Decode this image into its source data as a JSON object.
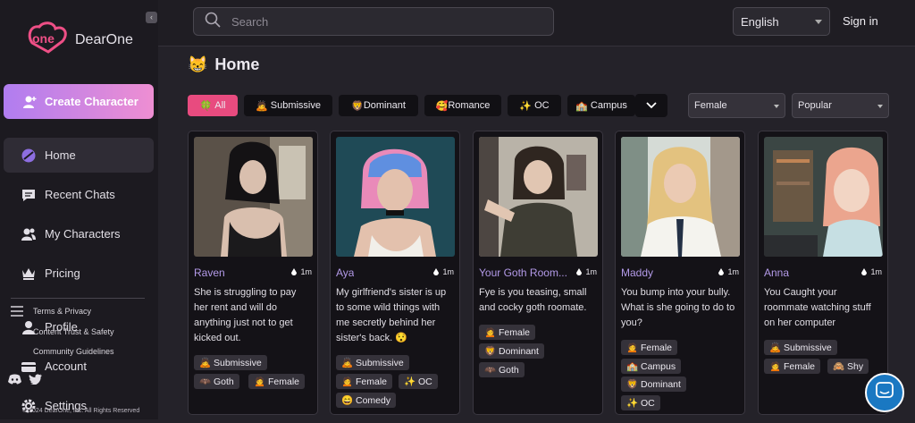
{
  "brand": {
    "name": "DearOne",
    "logo_mark": "one"
  },
  "sidebar": {
    "create_label": "Create Character",
    "nav": [
      {
        "label": "Home",
        "icon": "home-icon",
        "active": true
      },
      {
        "label": "Recent Chats",
        "icon": "chat-icon"
      },
      {
        "label": "My Characters",
        "icon": "users-icon"
      },
      {
        "label": "Pricing",
        "icon": "crown-icon"
      },
      {
        "label": "Profile",
        "icon": "user-icon"
      },
      {
        "label": "Account",
        "icon": "card-icon"
      },
      {
        "label": "Settings",
        "icon": "gear-icon"
      }
    ],
    "footer_links": [
      "Terms & Privacy",
      "Content Trust & Safety",
      "Community Guidelines"
    ],
    "copyright": "© 2024 DearOne, Inc. All Rights Reserved"
  },
  "header": {
    "search_placeholder": "Search",
    "language": "English",
    "signin_label": "Sign in"
  },
  "page": {
    "title": "Home",
    "title_icon": "😸"
  },
  "filters": {
    "chips": [
      {
        "emoji": "🍀",
        "label": "All",
        "selected": true
      },
      {
        "emoji": "🙇",
        "label": "Submissive"
      },
      {
        "emoji": "🦁",
        "label": "Dominant"
      },
      {
        "emoji": "🥰",
        "label": "Romance"
      },
      {
        "emoji": "✨",
        "label": "OC"
      },
      {
        "emoji": "🏫",
        "label": "Campus"
      }
    ],
    "gender": "Female",
    "sort": "Popular"
  },
  "cards": [
    {
      "name": "Raven",
      "time": "1m",
      "desc": "She is struggling to pay her rent and will do anything just not to get kicked out.",
      "tags": [
        [
          "🙇",
          "Submissive"
        ],
        [
          "🦇",
          "Goth"
        ],
        [
          "🙍",
          "Female"
        ]
      ]
    },
    {
      "name": "Aya",
      "time": "1m",
      "desc": "My girlfriend's sister is up to some wild things with me secretly behind her sister's back. 😯",
      "tags": [
        [
          "🙇",
          "Submissive"
        ],
        [
          "🙍",
          "Female"
        ],
        [
          "✨",
          "OC"
        ],
        [
          "😄",
          "Comedy"
        ]
      ]
    },
    {
      "name": "Your Goth Room...",
      "time": "1m",
      "desc": "Fye is you teasing, small and cocky goth roomate.",
      "tags": [
        [
          "🙍",
          "Female"
        ],
        [
          "🦁",
          "Dominant"
        ],
        [
          "🦇",
          "Goth"
        ]
      ]
    },
    {
      "name": "Maddy",
      "time": "1m",
      "desc": "You bump into your bully. What is she going to do to you?",
      "tags": [
        [
          "🙍",
          "Female"
        ],
        [
          "🏫",
          "Campus"
        ],
        [
          "🦁",
          "Dominant"
        ],
        [
          "✨",
          "OC"
        ]
      ]
    },
    {
      "name": "Anna",
      "time": "1m",
      "desc": "You Caught your roommate watching stuff on her computer",
      "tags": [
        [
          "🙇",
          "Submissive"
        ],
        [
          "🙍",
          "Female"
        ],
        [
          "🙈",
          "Shy"
        ]
      ]
    }
  ],
  "colors": {
    "accent": "#e84b7f",
    "name": "#b39ae8",
    "create_from": "#b07df0",
    "create_to": "#ee8ed2"
  }
}
